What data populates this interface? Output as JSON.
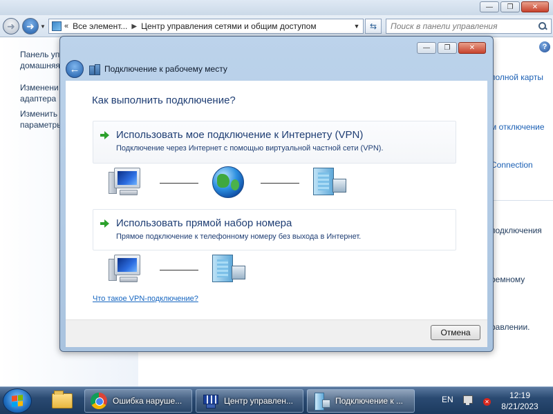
{
  "explorer": {
    "breadcrumb": [
      "Все элемент...",
      "Центр управления сетями и общим доступом"
    ],
    "search_placeholder": "Поиск в панели управления",
    "left_links": [
      "Панель уп",
      "домашняя",
      "Изменени",
      "адаптера",
      "Изменить",
      "параметры"
    ],
    "right_fragments": [
      "полной карты",
      "м отключение",
      "Connection",
      "подключения",
      "ремному",
      "равлении."
    ]
  },
  "dialog": {
    "title": "Подключение к рабочему месту",
    "question": "Как выполнить подключение?",
    "options": [
      {
        "title": "Использовать мое подключение к Интернету (VPN)",
        "description": "Подключение через Интернет с помощью виртуальной частной сети (VPN)."
      },
      {
        "title": "Использовать прямой набор номера",
        "description": "Прямое подключение к телефонному номеру без выхода в Интернет."
      }
    ],
    "help_link": "Что такое VPN-подключение?",
    "cancel_label": "Отмена"
  },
  "taskbar": {
    "buttons": [
      {
        "label": "Ошибка наруше...",
        "icon": "chrome-icon"
      },
      {
        "label": "Центр управлен...",
        "icon": "network-center-icon"
      },
      {
        "label": "Подключение к ...",
        "icon": "server-icon",
        "active": true
      }
    ],
    "language": "EN",
    "time": "12:19",
    "date": "8/21/2023"
  }
}
